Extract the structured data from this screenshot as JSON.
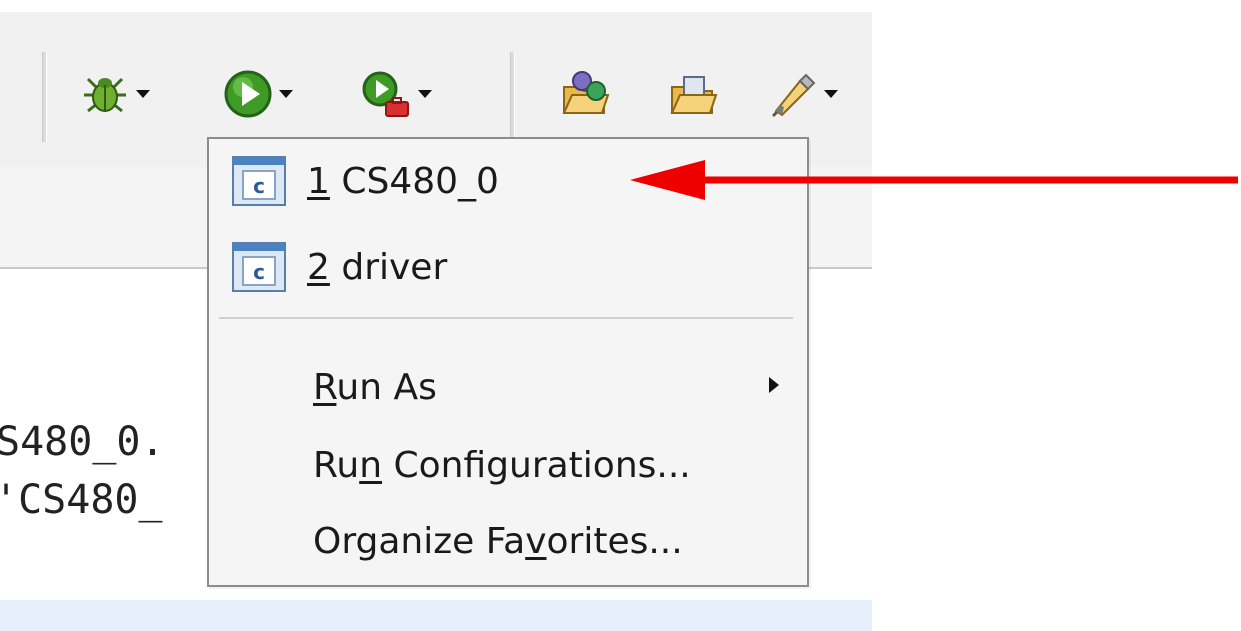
{
  "toolbar": {
    "buttons": [
      {
        "name": "debug",
        "icon": "bug-icon"
      },
      {
        "name": "run",
        "icon": "run-icon"
      },
      {
        "name": "external-tools",
        "icon": "external-tools-icon"
      },
      {
        "name": "open-type",
        "icon": "open-type-folder-icon"
      },
      {
        "name": "open-task",
        "icon": "open-task-folder-icon"
      },
      {
        "name": "pen",
        "icon": "pen-icon"
      }
    ]
  },
  "editor": {
    "line1": "S480_0.",
    "line2": "'CS480_"
  },
  "run_menu": {
    "recent": [
      {
        "mnemonic": "1",
        "label": " CS480_0",
        "icon": "java-class-icon"
      },
      {
        "mnemonic": "2",
        "label": " driver",
        "icon": "java-class-icon"
      }
    ],
    "run_as": {
      "pre": "",
      "mnemonic": "R",
      "post": "un As"
    },
    "run_configurations": {
      "pre": "Ru",
      "mnemonic": "n",
      "post": " Configurations..."
    },
    "organize_favorites": {
      "pre": "Organize Fa",
      "mnemonic": "v",
      "post": "orites..."
    }
  },
  "annotation": {
    "arrow_color": "#ee0000"
  },
  "colors": {
    "menu_bg": "#f5f5f5",
    "toolbar_bg": "#f1f1f1",
    "highlight": "#e6effb"
  }
}
